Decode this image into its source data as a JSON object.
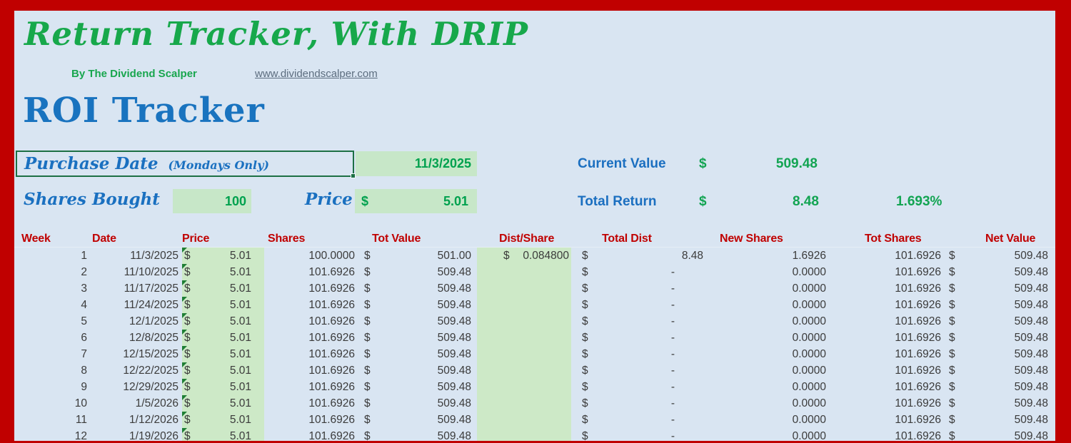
{
  "colors": {
    "frame_red": "#c00000",
    "canvas_blue": "#d9e5f2",
    "brand_green": "#17a84b",
    "heading_blue": "#1973bf",
    "value_green": "#00a14e",
    "input_cell_green": "#c7e7c8",
    "table_col_green": "#cde9c7",
    "selection_border_green": "#1d7044",
    "table_header_red": "#c00000"
  },
  "header": {
    "title": "Return Tracker, With DRIP",
    "byline": "By The Dividend Scalper",
    "website": "www.dividendscalper.com"
  },
  "section": {
    "title": "ROI Tracker"
  },
  "inputs": {
    "purchase_date_label": "Purchase Date",
    "purchase_date_note": "(Mondays Only)",
    "purchase_date_value": "11/3/2025",
    "shares_bought_label": "Shares Bought",
    "shares_bought_value": "100",
    "price_label": "Price",
    "price_currency": "$",
    "price_value": "5.01"
  },
  "summary": {
    "current_value_label": "Current Value",
    "current_value_currency": "$",
    "current_value": "509.48",
    "total_return_label": "Total Return",
    "total_return_currency": "$",
    "total_return": "8.48",
    "total_return_pct": "1.693%"
  },
  "table": {
    "columns": [
      "Week",
      "Date",
      "Price",
      "Shares",
      "Tot Value",
      "Dist/Share",
      "Total Dist",
      "New Shares",
      "Tot Shares",
      "Net Value"
    ],
    "rows": [
      {
        "week": "1",
        "date": "11/3/2025",
        "price_currency": "$",
        "price": "5.01",
        "shares": "100.0000",
        "tot_value_currency": "$",
        "tot_value": "501.00",
        "dist_currency": "$",
        "dist_share": "0.084800",
        "total_dist_currency": "$",
        "total_dist": "8.48",
        "new_shares": "1.6926",
        "tot_shares": "101.6926",
        "net_value_currency": "$",
        "net_value": "509.48"
      },
      {
        "week": "2",
        "date": "11/10/2025",
        "price_currency": "$",
        "price": "5.01",
        "shares": "101.6926",
        "tot_value_currency": "$",
        "tot_value": "509.48",
        "dist_currency": "",
        "dist_share": "",
        "total_dist_currency": "$",
        "total_dist": "-",
        "new_shares": "0.0000",
        "tot_shares": "101.6926",
        "net_value_currency": "$",
        "net_value": "509.48"
      },
      {
        "week": "3",
        "date": "11/17/2025",
        "price_currency": "$",
        "price": "5.01",
        "shares": "101.6926",
        "tot_value_currency": "$",
        "tot_value": "509.48",
        "dist_currency": "",
        "dist_share": "",
        "total_dist_currency": "$",
        "total_dist": "-",
        "new_shares": "0.0000",
        "tot_shares": "101.6926",
        "net_value_currency": "$",
        "net_value": "509.48"
      },
      {
        "week": "4",
        "date": "11/24/2025",
        "price_currency": "$",
        "price": "5.01",
        "shares": "101.6926",
        "tot_value_currency": "$",
        "tot_value": "509.48",
        "dist_currency": "",
        "dist_share": "",
        "total_dist_currency": "$",
        "total_dist": "-",
        "new_shares": "0.0000",
        "tot_shares": "101.6926",
        "net_value_currency": "$",
        "net_value": "509.48"
      },
      {
        "week": "5",
        "date": "12/1/2025",
        "price_currency": "$",
        "price": "5.01",
        "shares": "101.6926",
        "tot_value_currency": "$",
        "tot_value": "509.48",
        "dist_currency": "",
        "dist_share": "",
        "total_dist_currency": "$",
        "total_dist": "-",
        "new_shares": "0.0000",
        "tot_shares": "101.6926",
        "net_value_currency": "$",
        "net_value": "509.48"
      },
      {
        "week": "6",
        "date": "12/8/2025",
        "price_currency": "$",
        "price": "5.01",
        "shares": "101.6926",
        "tot_value_currency": "$",
        "tot_value": "509.48",
        "dist_currency": "",
        "dist_share": "",
        "total_dist_currency": "$",
        "total_dist": "-",
        "new_shares": "0.0000",
        "tot_shares": "101.6926",
        "net_value_currency": "$",
        "net_value": "509.48"
      },
      {
        "week": "7",
        "date": "12/15/2025",
        "price_currency": "$",
        "price": "5.01",
        "shares": "101.6926",
        "tot_value_currency": "$",
        "tot_value": "509.48",
        "dist_currency": "",
        "dist_share": "",
        "total_dist_currency": "$",
        "total_dist": "-",
        "new_shares": "0.0000",
        "tot_shares": "101.6926",
        "net_value_currency": "$",
        "net_value": "509.48"
      },
      {
        "week": "8",
        "date": "12/22/2025",
        "price_currency": "$",
        "price": "5.01",
        "shares": "101.6926",
        "tot_value_currency": "$",
        "tot_value": "509.48",
        "dist_currency": "",
        "dist_share": "",
        "total_dist_currency": "$",
        "total_dist": "-",
        "new_shares": "0.0000",
        "tot_shares": "101.6926",
        "net_value_currency": "$",
        "net_value": "509.48"
      },
      {
        "week": "9",
        "date": "12/29/2025",
        "price_currency": "$",
        "price": "5.01",
        "shares": "101.6926",
        "tot_value_currency": "$",
        "tot_value": "509.48",
        "dist_currency": "",
        "dist_share": "",
        "total_dist_currency": "$",
        "total_dist": "-",
        "new_shares": "0.0000",
        "tot_shares": "101.6926",
        "net_value_currency": "$",
        "net_value": "509.48"
      },
      {
        "week": "10",
        "date": "1/5/2026",
        "price_currency": "$",
        "price": "5.01",
        "shares": "101.6926",
        "tot_value_currency": "$",
        "tot_value": "509.48",
        "dist_currency": "",
        "dist_share": "",
        "total_dist_currency": "$",
        "total_dist": "-",
        "new_shares": "0.0000",
        "tot_shares": "101.6926",
        "net_value_currency": "$",
        "net_value": "509.48"
      },
      {
        "week": "11",
        "date": "1/12/2026",
        "price_currency": "$",
        "price": "5.01",
        "shares": "101.6926",
        "tot_value_currency": "$",
        "tot_value": "509.48",
        "dist_currency": "",
        "dist_share": "",
        "total_dist_currency": "$",
        "total_dist": "-",
        "new_shares": "0.0000",
        "tot_shares": "101.6926",
        "net_value_currency": "$",
        "net_value": "509.48"
      },
      {
        "week": "12",
        "date": "1/19/2026",
        "price_currency": "$",
        "price": "5.01",
        "shares": "101.6926",
        "tot_value_currency": "$",
        "tot_value": "509.48",
        "dist_currency": "",
        "dist_share": "",
        "total_dist_currency": "$",
        "total_dist": "-",
        "new_shares": "0.0000",
        "tot_shares": "101.6926",
        "net_value_currency": "$",
        "net_value": "509.48"
      }
    ]
  }
}
